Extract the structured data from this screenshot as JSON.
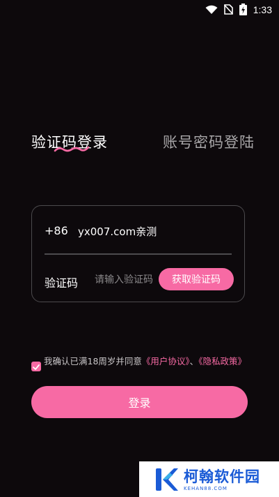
{
  "status_bar": {
    "time": "1:33"
  },
  "login_tabs": {
    "active": "验证码登录",
    "inactive": "账号密码登陆"
  },
  "form": {
    "country_code": "+86",
    "phone_value": "yx007.com亲测",
    "code_label": "验证码",
    "code_placeholder": "请输入验证码",
    "get_code_label": "获取验证码"
  },
  "agreement": {
    "checked": true,
    "prefix": "我确认已满18周岁并同意",
    "user_agreement": "《用户协议》",
    "separator": "、",
    "privacy_policy": "《隐私政策》"
  },
  "login_button": "登录",
  "watermark": {
    "name": "柯翰软件园",
    "url": "KEHAN88.COM"
  },
  "colors": {
    "accent": "#f76aa4",
    "background": "#0d090c",
    "watermark_blue": "#1a5bd6"
  }
}
